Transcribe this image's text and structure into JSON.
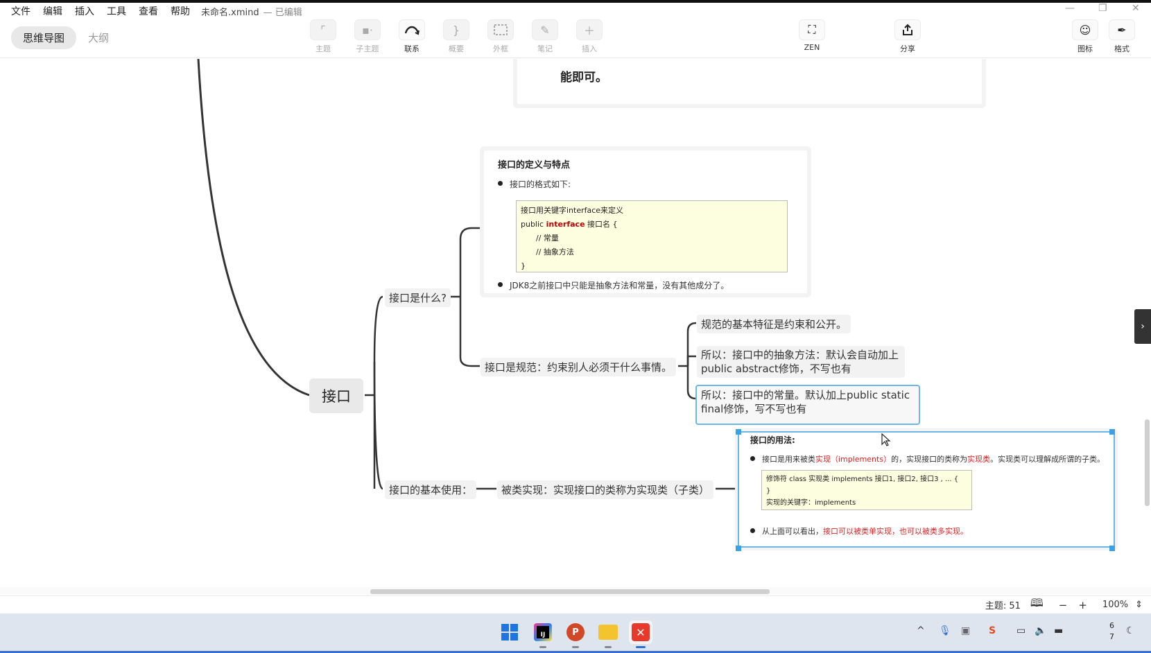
{
  "menu": [
    "文件",
    "编辑",
    "插入",
    "工具",
    "查看",
    "帮助"
  ],
  "file": {
    "name": "未命名.xmind",
    "status": "— 已编辑"
  },
  "window_controls": [
    "—",
    "❐",
    "✕"
  ],
  "view_tabs": {
    "mindmap": "思维导图",
    "outline": "大纲"
  },
  "tools": {
    "topic": "主题",
    "subtopic": "子主题",
    "relationship": "联系",
    "summary": "概要",
    "boundary": "外框",
    "note": "笔记",
    "insert": "插入",
    "zen": "ZEN",
    "share": "分享",
    "icon": "图标",
    "format": "格式"
  },
  "canvas": {
    "top_note_text": "能即可。",
    "central": "接口",
    "branch_what": "接口是什么?",
    "branch_spec": "接口是规范：约束别人必须干什么事情。",
    "spec_child_1": "规范的基本特征是约束和公开。",
    "spec_child_2": "所以：接口中的抽象方法：默认会自动加上public abstract修饰，不写也有",
    "spec_child_3": "所以：接口中的常量。默认加上public static final修饰，写不写也有",
    "branch_usage": "接口的基本使用：",
    "usage_child": "被类实现：实现接口的类称为实现类（子类）",
    "note_def": {
      "title": "接口的定义与特点",
      "bullet1": "接口的格式如下:",
      "code_line1": "接口用关键字interface来定义",
      "code_line2_pre": "public ",
      "code_line2_kw": "interface",
      "code_line2_post": " 接口名 {",
      "code_line3": "// 常量",
      "code_line4": "// 抽象方法",
      "code_line5": "}",
      "bullet2": "JDK8之前接口中只能是抽象方法和常量，没有其他成分了。"
    },
    "note_usage": {
      "title": "接口的用法:",
      "b1_part1": "接口是用来被类",
      "b1_red1": "实现（implements）",
      "b1_part2": "的，实现接口的类称为",
      "b1_red2": "实现类",
      "b1_part3": "。实现类可以理解成所谓的子类。",
      "code_line1": "修饰符 class 实现类 implements 接口1, 接口2, 接口3 , ... {",
      "code_line2": "}",
      "code_line3": "实现的关键字：implements",
      "b2_part1": "从上面可以看出，",
      "b2_red": "接口可以被类单实现，也可以被类多实现。"
    }
  },
  "status": {
    "topic_count": "主题: 51",
    "zoom": "100%",
    "zoom_minus": "−",
    "zoom_plus": "+"
  },
  "clock": {
    "line1": "6",
    "line2": "7"
  }
}
